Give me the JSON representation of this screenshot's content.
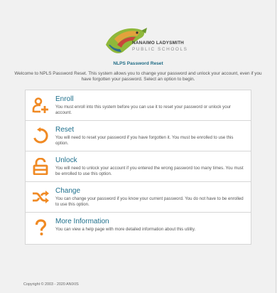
{
  "logo": {
    "line1": "NANAIMO LADYSMITH",
    "line2": "PUBLIC SCHOOLS"
  },
  "page_title": "NLPS Password Reset",
  "welcome_text": "Welcome to NPLS Password Reset. This system allows you to change your password and unlock your account, even if you have forgotten your password. Select an option to begin.",
  "accent_color": "#f08a24",
  "link_color": "#1e6f8c",
  "menu": [
    {
      "icon": "enroll-user-icon",
      "title": "Enroll",
      "description": "You must enroll into this system before you can use it to reset your password or unlock your account."
    },
    {
      "icon": "reset-arrow-icon",
      "title": "Reset",
      "description": "You will need to reset your password if you have forgotten it. You must be enrolled to use this option."
    },
    {
      "icon": "unlock-padlock-icon",
      "title": "Unlock",
      "description": "You will need to unlock your account if you entered the wrong password too many times. You must be enrolled to use this option."
    },
    {
      "icon": "shuffle-arrows-icon",
      "title": "Change",
      "description": "You can change your password if you know your current password. You do not have to be enrolled to use this option."
    },
    {
      "icon": "question-mark-icon",
      "title": "More Information",
      "description": "You can view a help page with more detailed information about this utility."
    }
  ],
  "copyright": "Copyright © 2003 - 2020 ANIXIS"
}
